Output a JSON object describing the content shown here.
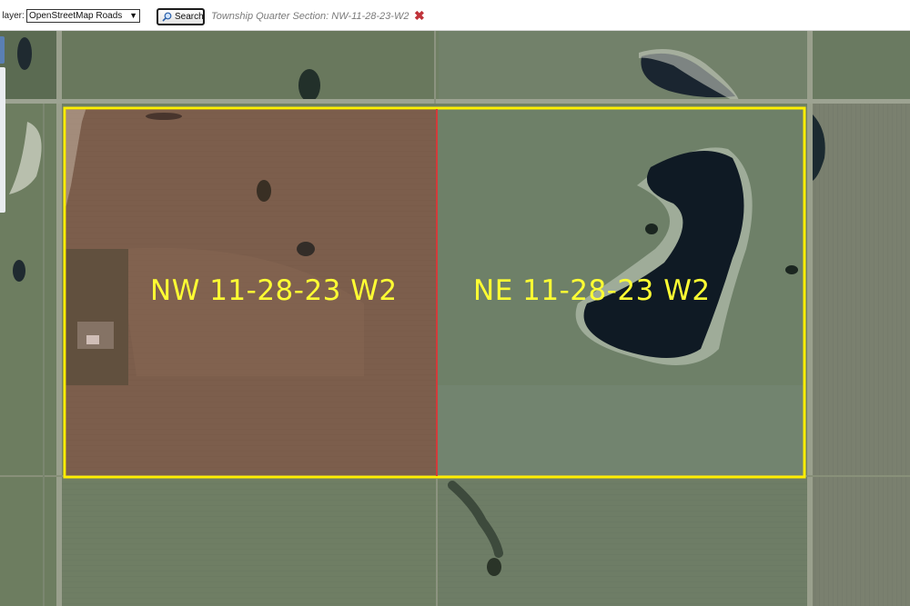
{
  "toolbar": {
    "base_layer_label": "e layer:",
    "layer_select_value": "OpenStreetMap Roads",
    "search_label": "Search",
    "section_label": "Township Quarter Section: NW-11-28-23-W2",
    "clear_icon": "close-icon"
  },
  "map": {
    "quarters": [
      {
        "label": "NW 11-28-23 W2"
      },
      {
        "label": "NE 11-28-23 W2"
      }
    ],
    "highlight_color": "#ffee00",
    "divider_color": "#d43a3a",
    "label_color": "#ffff33"
  }
}
